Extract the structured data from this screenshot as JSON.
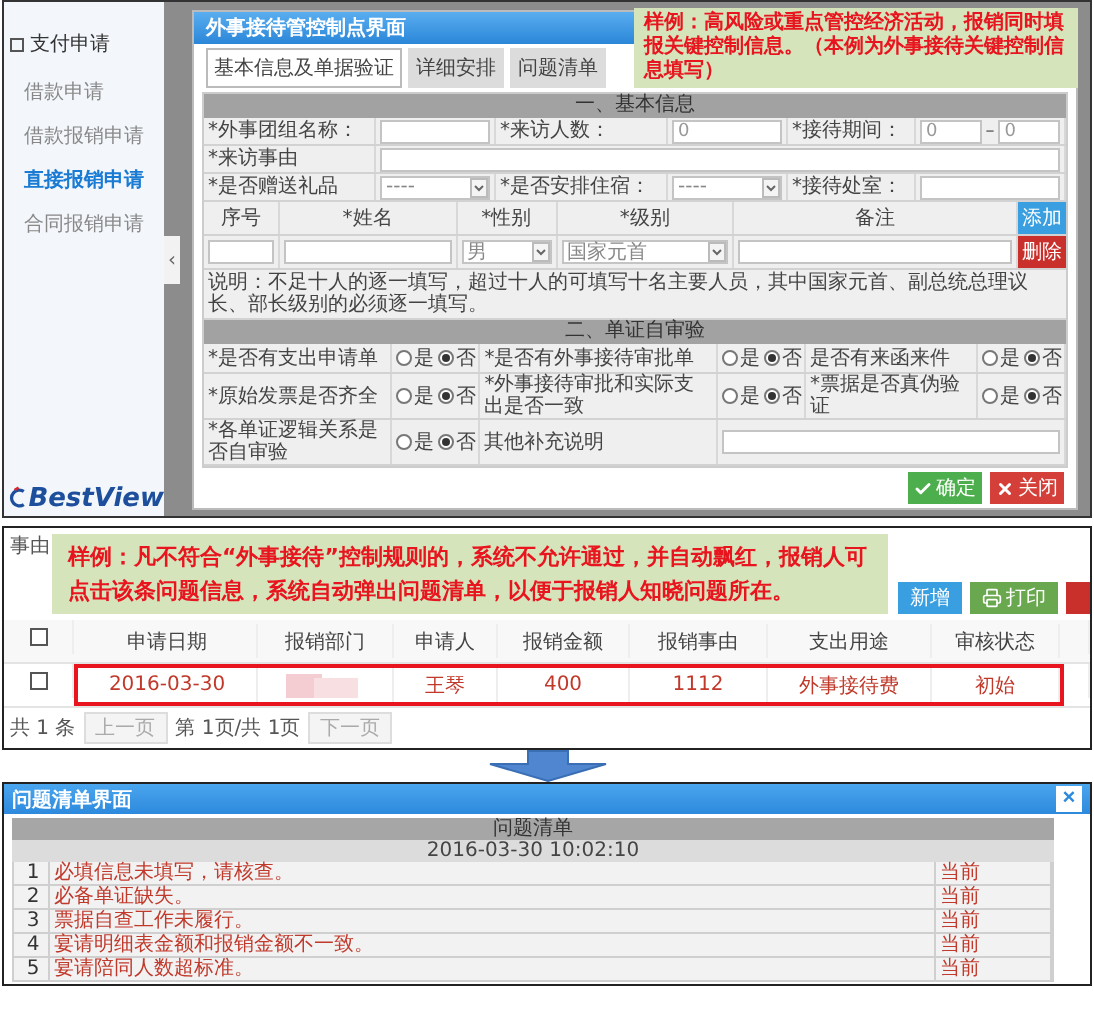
{
  "top_screen": {
    "sidebar": {
      "title": "支付申请",
      "items": [
        {
          "label": "借款申请",
          "selected": false
        },
        {
          "label": "借款报销申请",
          "selected": false
        },
        {
          "label": "直接报销申请",
          "selected": true
        },
        {
          "label": "合同报销申请",
          "selected": false
        }
      ],
      "logo": "BestView"
    },
    "collapse_handle": "‹",
    "callout": "样例：高风险或重点管控经济活动，报销同时填报关键控制信息。（本例为外事接待关键控制信息填写）",
    "dialog": {
      "title": "外事接待管控制点界面",
      "tabs": [
        {
          "label": "基本信息及单据验证",
          "selected": true
        },
        {
          "label": "详细安排",
          "selected": false
        },
        {
          "label": "问题清单",
          "selected": false
        }
      ],
      "basic_section": {
        "title": "一、基本信息",
        "rows": [
          [
            {
              "kind": "label",
              "text": "*外事团组名称："
            },
            {
              "kind": "input"
            },
            {
              "kind": "label",
              "text": "*来访人数："
            },
            {
              "kind": "input",
              "value": "0"
            },
            {
              "kind": "label",
              "text": "*接待期间："
            },
            {
              "kind": "range",
              "from": "0",
              "separator": "–",
              "to": "0"
            }
          ],
          [
            {
              "kind": "label",
              "text": "*来访事由"
            },
            {
              "kind": "wide_input"
            }
          ],
          [
            {
              "kind": "label",
              "text": "*是否赠送礼品"
            },
            {
              "kind": "select",
              "value": "----"
            },
            {
              "kind": "label",
              "text": "*是否安排住宿："
            },
            {
              "kind": "select",
              "value": "----"
            },
            {
              "kind": "label",
              "text": "*接待处室："
            },
            {
              "kind": "input"
            }
          ]
        ]
      },
      "persons": {
        "columns": [
          "序号",
          "*姓名",
          "*性别",
          "*级别",
          "备注"
        ],
        "add_button": "添加",
        "rows": [
          {
            "gender": "男",
            "level": "国家元首",
            "delete_button": "删除"
          }
        ]
      },
      "note": "说明：不足十人的逐一填写，超过十人的可填写十名主要人员，其中国家元首、副总统总理议长、部长级别的必须逐一填写。",
      "audit_section": {
        "title": "二、单证自审验",
        "rows": [
          [
            {
              "kind": "radio",
              "label": "*是否有支出申请单",
              "choices": [
                {
                  "text": "是",
                  "selected": false
                },
                {
                  "text": "否",
                  "selected": true
                }
              ]
            },
            {
              "kind": "radio",
              "label": "*是否有外事接待审批单",
              "choices": [
                {
                  "text": "是",
                  "selected": false
                },
                {
                  "text": "否",
                  "selected": true
                }
              ]
            },
            {
              "kind": "radio",
              "label": "是否有来函来件",
              "choices": [
                {
                  "text": "是",
                  "selected": false
                },
                {
                  "text": "否",
                  "selected": true
                }
              ]
            }
          ],
          [
            {
              "kind": "radio",
              "label": "*原始发票是否齐全",
              "choices": [
                {
                  "text": "是",
                  "selected": false
                },
                {
                  "text": "否",
                  "selected": true
                }
              ]
            },
            {
              "kind": "radio",
              "label": "*外事接待审批和实际支出是否一致",
              "choices": [
                {
                  "text": "是",
                  "selected": false
                },
                {
                  "text": "否",
                  "selected": true
                }
              ]
            },
            {
              "kind": "radio",
              "label": "*票据是否真伪验证",
              "choices": [
                {
                  "text": "是",
                  "selected": false
                },
                {
                  "text": "否",
                  "selected": true
                }
              ]
            }
          ],
          [
            {
              "kind": "radio",
              "label": "*各单证逻辑关系是否自审验",
              "choices": [
                {
                  "text": "是",
                  "selected": false
                },
                {
                  "text": "否",
                  "selected": true
                }
              ]
            },
            {
              "kind": "text",
              "label": "其他补充说明"
            }
          ]
        ]
      },
      "buttons": [
        {
          "label": "确定",
          "kind": "confirm"
        },
        {
          "label": "关闭",
          "kind": "close"
        }
      ]
    }
  },
  "list_screen": {
    "field_label": "事由",
    "callout": "样例：凡不符合“外事接待”控制规则的，系统不允许通过，并自动飘红，报销人可点击该条问题信息，系统自动弹出问题清单，以便于报销人知晓问题所在。",
    "buttons": [
      {
        "label": "新增",
        "kind": "add"
      },
      {
        "label": "打印",
        "kind": "print"
      },
      {
        "kind": "danger"
      }
    ],
    "table": {
      "header_checked": false,
      "columns": [
        "申请日期",
        "报销部门",
        "申请人",
        "报销金额",
        "报销事由",
        "支出用途",
        "审核状态"
      ],
      "rows": [
        {
          "checked": false,
          "flagged": true,
          "cells": [
            {
              "kind": "text",
              "text": "2016-03-30"
            },
            {
              "kind": "blurred"
            },
            {
              "kind": "text",
              "text": "王琴"
            },
            {
              "kind": "text",
              "text": "400"
            },
            {
              "kind": "text",
              "text": "1112"
            },
            {
              "kind": "text",
              "text": "外事接待费"
            },
            {
              "kind": "text",
              "text": "初始"
            }
          ]
        }
      ]
    },
    "pagination": {
      "total": "共 1 条",
      "prev": "上一页",
      "page": "第 1页/共 1页",
      "next": "下一页"
    }
  },
  "problem_dialog": {
    "title": "问题清单界面",
    "close": "×",
    "header": "问题清单",
    "timestamp": "2016-03-30 10:02:10",
    "rows": [
      {
        "index": "1",
        "message": "必填信息未填写，请核查。",
        "status": "当前"
      },
      {
        "index": "2",
        "message": "必备单证缺失。",
        "status": "当前"
      },
      {
        "index": "3",
        "message": "票据自查工作未履行。",
        "status": "当前"
      },
      {
        "index": "4",
        "message": "宴请明细表金额和报销金额不一致。",
        "status": "当前"
      },
      {
        "index": "5",
        "message": "宴请陪同人数超标准。",
        "status": "当前"
      }
    ]
  }
}
